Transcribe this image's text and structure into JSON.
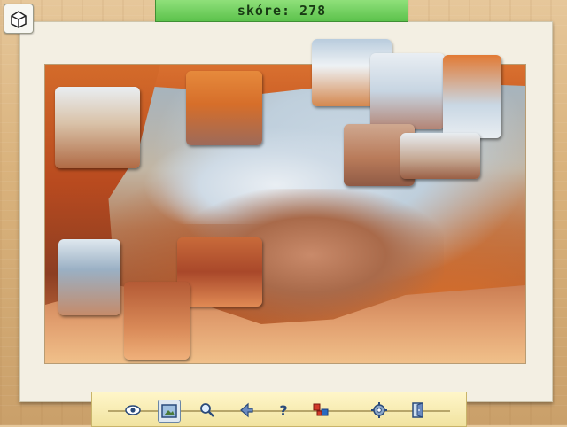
{
  "header": {
    "score_text": "skóre: 278"
  },
  "corner": {
    "icon": "puzzle-box-icon"
  },
  "toolbar": {
    "items": [
      {
        "icon": "eye-icon",
        "active": false
      },
      {
        "icon": "picture-frame-icon",
        "active": true
      },
      {
        "icon": "magnifier-icon",
        "active": false
      },
      {
        "icon": "sort-pieces-icon",
        "active": false
      },
      {
        "icon": "help-icon",
        "active": false
      },
      {
        "icon": "scatter-pieces-icon",
        "active": false
      },
      {
        "icon": "settings-gear-icon",
        "active": false
      },
      {
        "icon": "exit-door-icon",
        "active": false
      }
    ]
  },
  "colors": {
    "score_bg": "#5cc24c",
    "toolbar_bg": "#f1e3a0",
    "board_bg": "#f3efe3"
  }
}
